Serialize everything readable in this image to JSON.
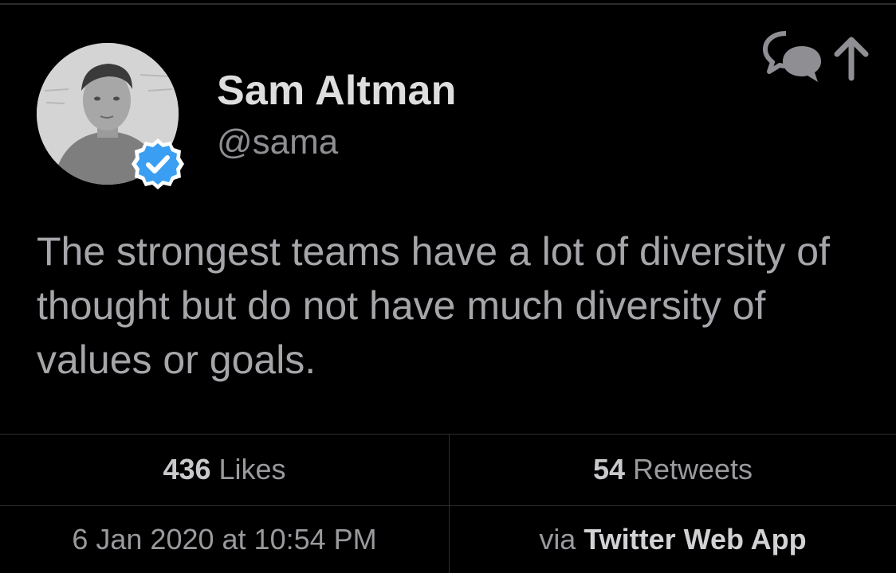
{
  "tweet": {
    "author_name": "Sam Altman",
    "author_handle": "@sama",
    "verified": true,
    "text": "The strongest teams have a lot of diversity of thought but do not have much diversity of values or goals.",
    "likes_count": "436",
    "likes_label": "Likes",
    "retweets_count": "54",
    "retweets_label": "Retweets",
    "timestamp": "6 Jan 2020 at 10:54 PM",
    "via_label": "via",
    "via_app": "Twitter Web App"
  },
  "icons": {
    "reply": "conversation-bubbles-icon",
    "share": "share-arrow-up-icon",
    "verified": "verified-badge-icon"
  },
  "colors": {
    "background": "#000000",
    "verified_blue": "#3a9ff2",
    "name": "#dedede",
    "body_text": "#a6a6aa",
    "secondary_text": "#8e8e93"
  }
}
